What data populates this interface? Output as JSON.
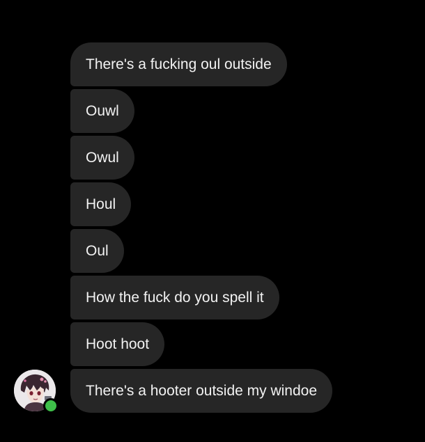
{
  "conversation": {
    "messages": [
      {
        "text": "There's a fucking oul outside"
      },
      {
        "text": "Ouwl"
      },
      {
        "text": "Owul"
      },
      {
        "text": "Houl"
      },
      {
        "text": "Oul"
      },
      {
        "text": "How the fuck do you spell it"
      },
      {
        "text": "Hoot hoot"
      },
      {
        "text": "There's a hooter outside my windoe"
      }
    ]
  },
  "sender": {
    "avatar_icon": "anime-character-avatar",
    "status": "online",
    "status_color": "#3fc04a"
  },
  "theme": {
    "background": "#000000",
    "bubble_color": "#262626",
    "text_color": "#f2f2f2"
  }
}
